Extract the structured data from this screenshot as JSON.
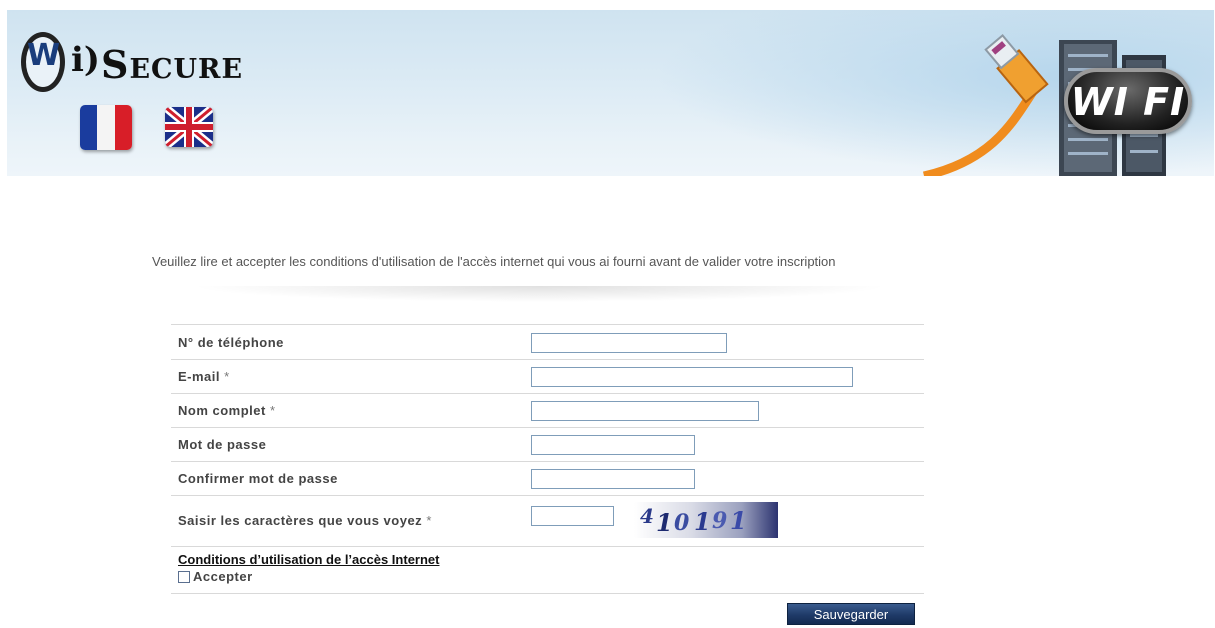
{
  "banner": {
    "logo_text": "WiSECURE",
    "logo_ring_letter": "W",
    "badge_text": "WI FI",
    "colors": {
      "sky": "#dcebf5",
      "cable": "#f08c1e",
      "badge": "#222222"
    },
    "languages": [
      {
        "code": "fr",
        "icon": "france-flag-icon"
      },
      {
        "code": "en",
        "icon": "uk-flag-icon"
      }
    ]
  },
  "notice": "Veuillez lire et accepter les conditions d'utilisation de l'accès internet qui vous ai fourni avant de valider votre inscription",
  "form": {
    "fields": [
      {
        "label": "N° de téléphone",
        "required": "",
        "value": ""
      },
      {
        "label": "E-mail",
        "required": "*",
        "value": ""
      },
      {
        "label": "Nom complet",
        "required": "*",
        "value": ""
      },
      {
        "label": "Mot de passe",
        "required": "",
        "value": ""
      },
      {
        "label": "Confirmer mot de passe",
        "required": "",
        "value": ""
      },
      {
        "label": "Saisir les caractères que vous voyez",
        "required": "*",
        "value": ""
      }
    ],
    "captcha_text": "410191",
    "terms_link": "Conditions d’utilisation de l’accès Internet",
    "accept_label": "Accepter",
    "accept_checked": false,
    "save_button": "Sauvegarder"
  }
}
